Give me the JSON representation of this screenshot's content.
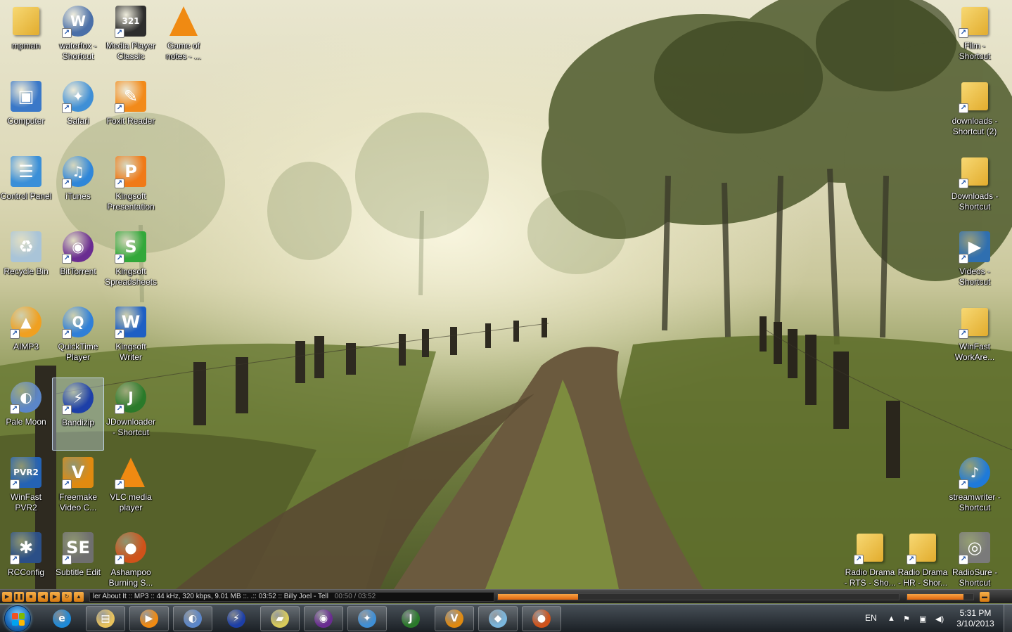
{
  "desktop": {
    "icons_left": [
      {
        "label": "mpman",
        "art": "user-folder-icon",
        "shortcut": false,
        "kind": "folder"
      },
      {
        "label": "waterfox - Shortcut",
        "art": "waterfox-icon",
        "shortcut": true,
        "kind": "round",
        "color": "#4a6fa8",
        "glyph": "W"
      },
      {
        "label": "Media Player Classic",
        "art": "media-player-classic-icon",
        "shortcut": true,
        "kind": "square",
        "color": "#2d2d2d",
        "glyph": "321"
      },
      {
        "label": "Game of notes - ...",
        "art": "vlc-cone-icon",
        "shortcut": false,
        "kind": "cone"
      },
      {
        "label": "Computer",
        "art": "computer-icon",
        "shortcut": false,
        "kind": "square",
        "color": "#3a78c8",
        "glyph": "▣"
      },
      {
        "label": "Safari",
        "art": "safari-compass-icon",
        "shortcut": true,
        "kind": "round",
        "color": "#3f8fd6",
        "glyph": "✦"
      },
      {
        "label": "Foxit Reader",
        "art": "foxit-reader-icon",
        "shortcut": true,
        "kind": "square",
        "color": "#f28a1a",
        "glyph": "✎"
      },
      {
        "label": "Control Panel",
        "art": "control-panel-icon",
        "shortcut": false,
        "kind": "square",
        "color": "#3a8fd8",
        "glyph": "☰"
      },
      {
        "label": "iTunes",
        "art": "itunes-icon",
        "shortcut": true,
        "kind": "round",
        "color": "#2f86d9",
        "glyph": "♫"
      },
      {
        "label": "Kingsoft Presentation",
        "art": "kingsoft-presentation-icon",
        "shortcut": true,
        "kind": "square",
        "color": "#f07a18",
        "glyph": "P"
      },
      {
        "label": "Recycle Bin",
        "art": "recycle-bin-icon",
        "shortcut": false,
        "kind": "square",
        "color": "#a9c4d8",
        "glyph": "♻"
      },
      {
        "label": "BitTorrent",
        "art": "bittorrent-icon",
        "shortcut": true,
        "kind": "round",
        "color": "#6a2c91",
        "glyph": "◉"
      },
      {
        "label": "Kingsoft Spreadsheets",
        "art": "kingsoft-spreadsheets-icon",
        "shortcut": true,
        "kind": "square",
        "color": "#32a83a",
        "glyph": "S"
      },
      {
        "label": "AIMP3",
        "art": "aimp3-icon",
        "shortcut": true,
        "kind": "round",
        "color": "#f0a020",
        "glyph": "▲"
      },
      {
        "label": "QuickTime Player",
        "art": "quicktime-icon",
        "shortcut": true,
        "kind": "round",
        "color": "#2f7fd8",
        "glyph": "Q"
      },
      {
        "label": "Kingsoft Writer",
        "art": "kingsoft-writer-icon",
        "shortcut": true,
        "kind": "square",
        "color": "#1e5fc4",
        "glyph": "W"
      },
      {
        "label": "Pale Moon",
        "art": "pale-moon-icon",
        "shortcut": true,
        "kind": "round",
        "color": "#5b86c9",
        "glyph": "◐"
      },
      {
        "label": "Bandizip",
        "art": "bandizip-icon",
        "shortcut": true,
        "kind": "round",
        "color": "#1d3fa8",
        "glyph": "⚡",
        "selected": true
      },
      {
        "label": "JDownloader - Shortcut",
        "art": "jdownloader-icon",
        "shortcut": true,
        "kind": "round",
        "color": "#2a7a2a",
        "glyph": "J"
      },
      {
        "label": "WinFast PVR2",
        "art": "winfast-pvr2-icon",
        "shortcut": true,
        "kind": "square",
        "color": "#2463b5",
        "glyph": "PVR2"
      },
      {
        "label": "Freemake Video C...",
        "art": "freemake-video-icon",
        "shortcut": true,
        "kind": "square",
        "color": "#e08a10",
        "glyph": "V"
      },
      {
        "label": "VLC media player",
        "art": "vlc-cone-icon",
        "shortcut": true,
        "kind": "cone"
      },
      {
        "label": "RCConfig",
        "art": "rcconfig-icon",
        "shortcut": true,
        "kind": "square",
        "color": "#2b4f87",
        "glyph": "✱"
      },
      {
        "label": "Subtitle Edit",
        "art": "subtitle-edit-icon",
        "shortcut": true,
        "kind": "square",
        "color": "#6f6f6f",
        "glyph": "SE"
      },
      {
        "label": "Ashampoo Burning S...",
        "art": "ashampoo-burning-icon",
        "shortcut": true,
        "kind": "round",
        "color": "#d0521a",
        "glyph": "●"
      }
    ],
    "icons_right": [
      {
        "label": "Film - Shortcut",
        "art": "folder-shortcut-icon",
        "kind": "folder"
      },
      {
        "label": "downloads - Shortcut (2)",
        "art": "folder-shortcut-icon",
        "kind": "folder"
      },
      {
        "label": "Downloads - Shortcut",
        "art": "folder-shortcut-icon",
        "kind": "folder"
      },
      {
        "label": "Videos - Shortcut",
        "art": "videos-shortcut-icon",
        "kind": "square",
        "color": "#2f6fb0",
        "glyph": "▶"
      },
      {
        "label": "WinFast WorkAre...",
        "art": "folder-shortcut-icon",
        "kind": "folder"
      },
      {
        "label": "streamwriter - Shortcut",
        "art": "streamwriter-icon",
        "kind": "round",
        "color": "#1f7ad9",
        "glyph": "♪"
      },
      {
        "label": "Radio Drama - RTS - Sho...",
        "art": "folder-shortcut-icon",
        "kind": "folder"
      },
      {
        "label": "Radio Drama - HR - Shor...",
        "art": "folder-shortcut-icon",
        "kind": "folder"
      },
      {
        "label": "RadioSure - Shortcut",
        "art": "radiosure-speaker-icon",
        "kind": "square",
        "color": "#7a7a7a",
        "glyph": "◎"
      }
    ]
  },
  "media_bar": {
    "track_info": "ler About It :: MP3 :: 44 kHz, 320 kbps, 9.01 MB ::.         .:: 03:52 :: Billy Joel - Tell",
    "time_display": "00:50 / 03:52",
    "progress": 0.2,
    "volume": 0.85,
    "buttons": [
      "play",
      "pause",
      "stop",
      "prev",
      "next",
      "repeat",
      "open"
    ]
  },
  "taskbar": {
    "buttons": [
      {
        "name": "internet-explorer",
        "glyph": "e",
        "color": "#1f8ad8",
        "pinned": true
      },
      {
        "name": "windows-explorer",
        "glyph": "▤",
        "color": "#e8c25c",
        "pinned": false
      },
      {
        "name": "media-player",
        "glyph": "▶",
        "color": "#f08a12",
        "pinned": false
      },
      {
        "name": "pale-moon",
        "glyph": "◐",
        "color": "#5b86c9",
        "pinned": false
      },
      {
        "name": "bandizip",
        "glyph": "⚡",
        "color": "#1d3fa8",
        "pinned": true
      },
      {
        "name": "sticky-notes",
        "glyph": "▰",
        "color": "#d9cb5a",
        "pinned": false
      },
      {
        "name": "bittorrent",
        "glyph": "◉",
        "color": "#6a2c91",
        "pinned": false
      },
      {
        "name": "safari",
        "glyph": "✦",
        "color": "#3f8fd6",
        "pinned": false
      },
      {
        "name": "jdownloader",
        "glyph": "J",
        "color": "#2a7a2a",
        "pinned": true
      },
      {
        "name": "freemake",
        "glyph": "V",
        "color": "#e08a10",
        "pinned": false
      },
      {
        "name": "glass-app",
        "glyph": "◆",
        "color": "#7ab6dd",
        "pinned": false
      },
      {
        "name": "ashampoo",
        "glyph": "●",
        "color": "#d0521a",
        "pinned": false
      }
    ],
    "language": "EN",
    "time": "5:31 PM",
    "date": "3/10/2013"
  }
}
